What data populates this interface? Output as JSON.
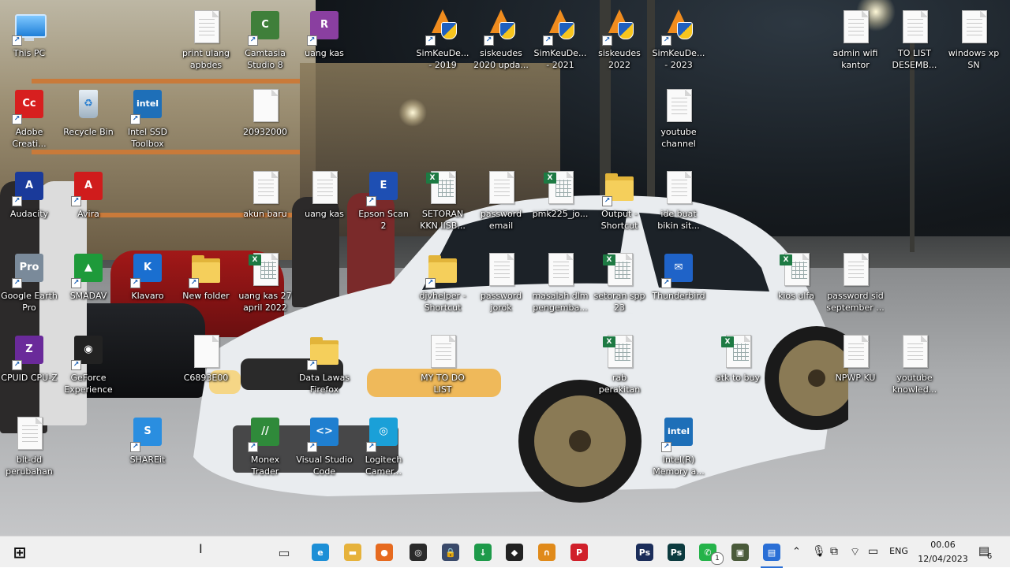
{
  "desktop": {
    "icons": [
      {
        "label": "This PC",
        "icon": "this-pc-icon",
        "kind": "monitor"
      },
      {
        "label": "print ulang apbdes",
        "icon": "document-icon",
        "kind": "doc"
      },
      {
        "label": "Camtasia Studio 8",
        "icon": "camtasia-icon",
        "kind": "app",
        "color": "#3f7f3a",
        "glyph": "C"
      },
      {
        "label": "uang kas",
        "icon": "winrar-icon",
        "kind": "app",
        "color": "#8a3fa0",
        "glyph": "R"
      },
      {
        "label": "SimKeuDe... - 2019",
        "icon": "simkeudes-icon",
        "kind": "siskeu"
      },
      {
        "label": "siskeudes 2020 upda...",
        "icon": "simkeudes-icon",
        "kind": "siskeu"
      },
      {
        "label": "SimKeuDe... - 2021",
        "icon": "simkeudes-icon",
        "kind": "siskeu"
      },
      {
        "label": "siskeudes 2022",
        "icon": "simkeudes-icon",
        "kind": "siskeu"
      },
      {
        "label": "SimKeuDe... - 2023",
        "icon": "simkeudes-icon",
        "kind": "siskeu"
      },
      {
        "label": "admin wifi kantor",
        "icon": "document-icon",
        "kind": "doc"
      },
      {
        "label": "TO LIST DESEMB...",
        "icon": "document-icon",
        "kind": "doc"
      },
      {
        "label": "windows xp SN",
        "icon": "document-icon",
        "kind": "doc"
      },
      {
        "label": "Adobe Creati...",
        "icon": "adobe-cc-icon",
        "kind": "app",
        "color": "#d71f1f",
        "glyph": "Cc"
      },
      {
        "label": "Recycle Bin",
        "icon": "recycle-bin-icon",
        "kind": "bin"
      },
      {
        "label": "Intel SSD Toolbox",
        "icon": "intel-icon",
        "kind": "app",
        "color": "#1e6fb8",
        "glyph": "intel"
      },
      {
        "label": "20932000",
        "icon": "document-icon",
        "kind": "blank"
      },
      {
        "label": "youtube channel",
        "icon": "document-icon",
        "kind": "doc"
      },
      {
        "label": "Audacity",
        "icon": "audacity-icon",
        "kind": "app",
        "color": "#1a3a9a",
        "glyph": "A"
      },
      {
        "label": "Avira",
        "icon": "avira-icon",
        "kind": "app",
        "color": "#d01c1c",
        "glyph": "A"
      },
      {
        "label": "akun baru",
        "icon": "document-icon",
        "kind": "doc"
      },
      {
        "label": "uang kas",
        "icon": "document-icon",
        "kind": "doc"
      },
      {
        "label": "Epson Scan 2",
        "icon": "epson-scan-icon",
        "kind": "app",
        "color": "#1e4fb3",
        "glyph": "E"
      },
      {
        "label": "SETORAN KKN IISB...",
        "icon": "excel-sheet-icon",
        "kind": "sheet"
      },
      {
        "label": "password email",
        "icon": "document-icon",
        "kind": "doc"
      },
      {
        "label": "pmk225_jo...",
        "icon": "excel-sheet-icon",
        "kind": "sheet"
      },
      {
        "label": "Output - Shortcut",
        "icon": "folder-icon",
        "kind": "folder"
      },
      {
        "label": "ide buat bikin sit...",
        "icon": "document-icon",
        "kind": "doc"
      },
      {
        "label": "Google Earth Pro",
        "icon": "google-earth-icon",
        "kind": "app",
        "color": "#7a8a9a",
        "glyph": "Pro"
      },
      {
        "label": "SMADAV",
        "icon": "smadav-icon",
        "kind": "app",
        "color": "#1e9a3a",
        "glyph": "▲"
      },
      {
        "label": "Klavaro",
        "icon": "klavaro-icon",
        "kind": "app",
        "color": "#1a6fd0",
        "glyph": "K"
      },
      {
        "label": "New folder",
        "icon": "folder-icon",
        "kind": "folder"
      },
      {
        "label": "uang kas 27 april 2022",
        "icon": "excel-sheet-icon",
        "kind": "sheet"
      },
      {
        "label": "djvhelper - Shortcut",
        "icon": "djvu-icon",
        "kind": "folder"
      },
      {
        "label": "password jorok",
        "icon": "document-icon",
        "kind": "doc"
      },
      {
        "label": "masalah dlm pengemba...",
        "icon": "document-icon",
        "kind": "doc"
      },
      {
        "label": "setoran spp 23 septemb...",
        "icon": "excel-sheet-icon",
        "kind": "sheet"
      },
      {
        "label": "Thunderbird",
        "icon": "thunderbird-icon",
        "kind": "app",
        "color": "#1f63c8",
        "glyph": "✉"
      },
      {
        "label": "kios ulfa",
        "icon": "excel-sheet-icon",
        "kind": "sheet"
      },
      {
        "label": "password sid september ...",
        "icon": "document-icon",
        "kind": "doc"
      },
      {
        "label": "CPUID CPU-Z",
        "icon": "cpuz-icon",
        "kind": "app",
        "color": "#6a2a9a",
        "glyph": "Z"
      },
      {
        "label": "GeForce Experience",
        "icon": "geforce-icon",
        "kind": "app",
        "color": "#222",
        "glyph": "◉"
      },
      {
        "label": "C6893E00",
        "icon": "document-icon",
        "kind": "blank"
      },
      {
        "label": "Data Lawas Firefox",
        "icon": "folder-icon",
        "kind": "folder"
      },
      {
        "label": "MY TO DO LIST",
        "icon": "document-icon",
        "kind": "doc"
      },
      {
        "label": "rab perakitan komputer",
        "icon": "excel-sheet-icon",
        "kind": "sheet"
      },
      {
        "label": "atk to buy",
        "icon": "excel-sheet-icon",
        "kind": "sheet"
      },
      {
        "label": "NPWP KU",
        "icon": "document-icon",
        "kind": "doc"
      },
      {
        "label": "youtube knowled...",
        "icon": "document-icon",
        "kind": "doc"
      },
      {
        "label": "blt-dd perubahan",
        "icon": "document-icon",
        "kind": "doc"
      },
      {
        "label": "SHAREit",
        "icon": "shareit-icon",
        "kind": "app",
        "color": "#2a8ee0",
        "glyph": "S"
      },
      {
        "label": "Monex Trader",
        "icon": "monex-icon",
        "kind": "app",
        "color": "#2f8a3a",
        "glyph": "//"
      },
      {
        "label": "Visual Studio Code",
        "icon": "vscode-icon",
        "kind": "app",
        "color": "#1f7fd0",
        "glyph": "<>"
      },
      {
        "label": "Logitech Camer...",
        "icon": "logitech-camera-icon",
        "kind": "app",
        "color": "#1aa0d8",
        "glyph": "◎"
      },
      {
        "label": "Intel(R) Memory a...",
        "icon": "intel-icon",
        "kind": "app",
        "color": "#1e6fb8",
        "glyph": "intel"
      }
    ]
  },
  "taskbar": {
    "apps": [
      {
        "name": "start-button",
        "icon": "windows-start-icon",
        "color": "#111",
        "glyph": "⊞"
      },
      {
        "name": "task-view-button",
        "icon": "task-view-icon",
        "color": "#333",
        "glyph": "▭"
      },
      {
        "name": "taskbar-edge",
        "icon": "edge-icon",
        "color": "#1d8fd6",
        "glyph": "e"
      },
      {
        "name": "taskbar-file-explorer",
        "icon": "folder-icon",
        "color": "#e6b23b",
        "glyph": "▬"
      },
      {
        "name": "taskbar-firefox",
        "icon": "firefox-icon",
        "color": "#e66a1f",
        "glyph": "●"
      },
      {
        "name": "taskbar-media-app",
        "icon": "media-disc-icon",
        "color": "#2a2a2a",
        "glyph": "◎"
      },
      {
        "name": "taskbar-vpn-app",
        "icon": "lock-icon",
        "color": "#3a4a6a",
        "glyph": "🔒"
      },
      {
        "name": "taskbar-download-app",
        "icon": "download-icon",
        "color": "#1e9a4a",
        "glyph": "↓"
      },
      {
        "name": "taskbar-inkscape",
        "icon": "inkscape-icon",
        "color": "#222",
        "glyph": "◆"
      },
      {
        "name": "taskbar-audacity",
        "icon": "audacity-icon",
        "color": "#e08a1a",
        "glyph": "∩"
      },
      {
        "name": "taskbar-pinterest",
        "icon": "pinterest-icon",
        "color": "#d0202a",
        "glyph": "P"
      },
      {
        "name": "taskbar-photoshop-1",
        "icon": "photoshop-icon",
        "color": "#1b2d5a",
        "glyph": "Ps"
      },
      {
        "name": "taskbar-photoshop-2",
        "icon": "photoshop-icon",
        "color": "#0c3b3f",
        "glyph": "Ps"
      },
      {
        "name": "taskbar-whatsapp",
        "icon": "whatsapp-icon",
        "color": "#25b34a",
        "glyph": "✆"
      },
      {
        "name": "taskbar-app-extra",
        "icon": "app-icon",
        "color": "#4a5a3a",
        "glyph": "▣"
      },
      {
        "name": "taskbar-active-app",
        "icon": "document-icon",
        "color": "#2a6fd6",
        "glyph": "▤"
      }
    ],
    "whatsapp_badge": "1",
    "tray": {
      "lang": "ENG",
      "time": "00.06",
      "date": "12/04/2023",
      "notifications": "6"
    }
  }
}
